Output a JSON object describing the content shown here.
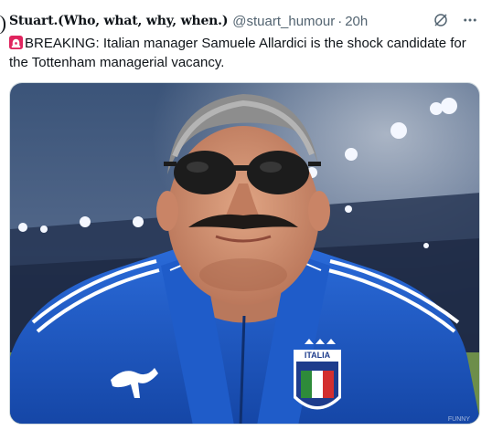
{
  "tweet": {
    "display_name": "Stuart.(Who, what, why, when.)",
    "handle": "@stuart_humour",
    "separator": "·",
    "time": "20h",
    "text": "BREAKING: Italian manager Samuele Allardici is the shock candidate for the Tottenham managerial vacancy.",
    "icons": {
      "grok": "grok-slash-icon",
      "more": "more-dots-icon",
      "siren": "rotating-light-icon"
    }
  },
  "image": {
    "crest_text": "ITALIA",
    "brand": "puma-logo",
    "watermark": "FUNNY"
  },
  "colors": {
    "text": "#0f1419",
    "muted": "#536471",
    "kit_blue": "#1a58c4",
    "border": "#cfd9de"
  }
}
